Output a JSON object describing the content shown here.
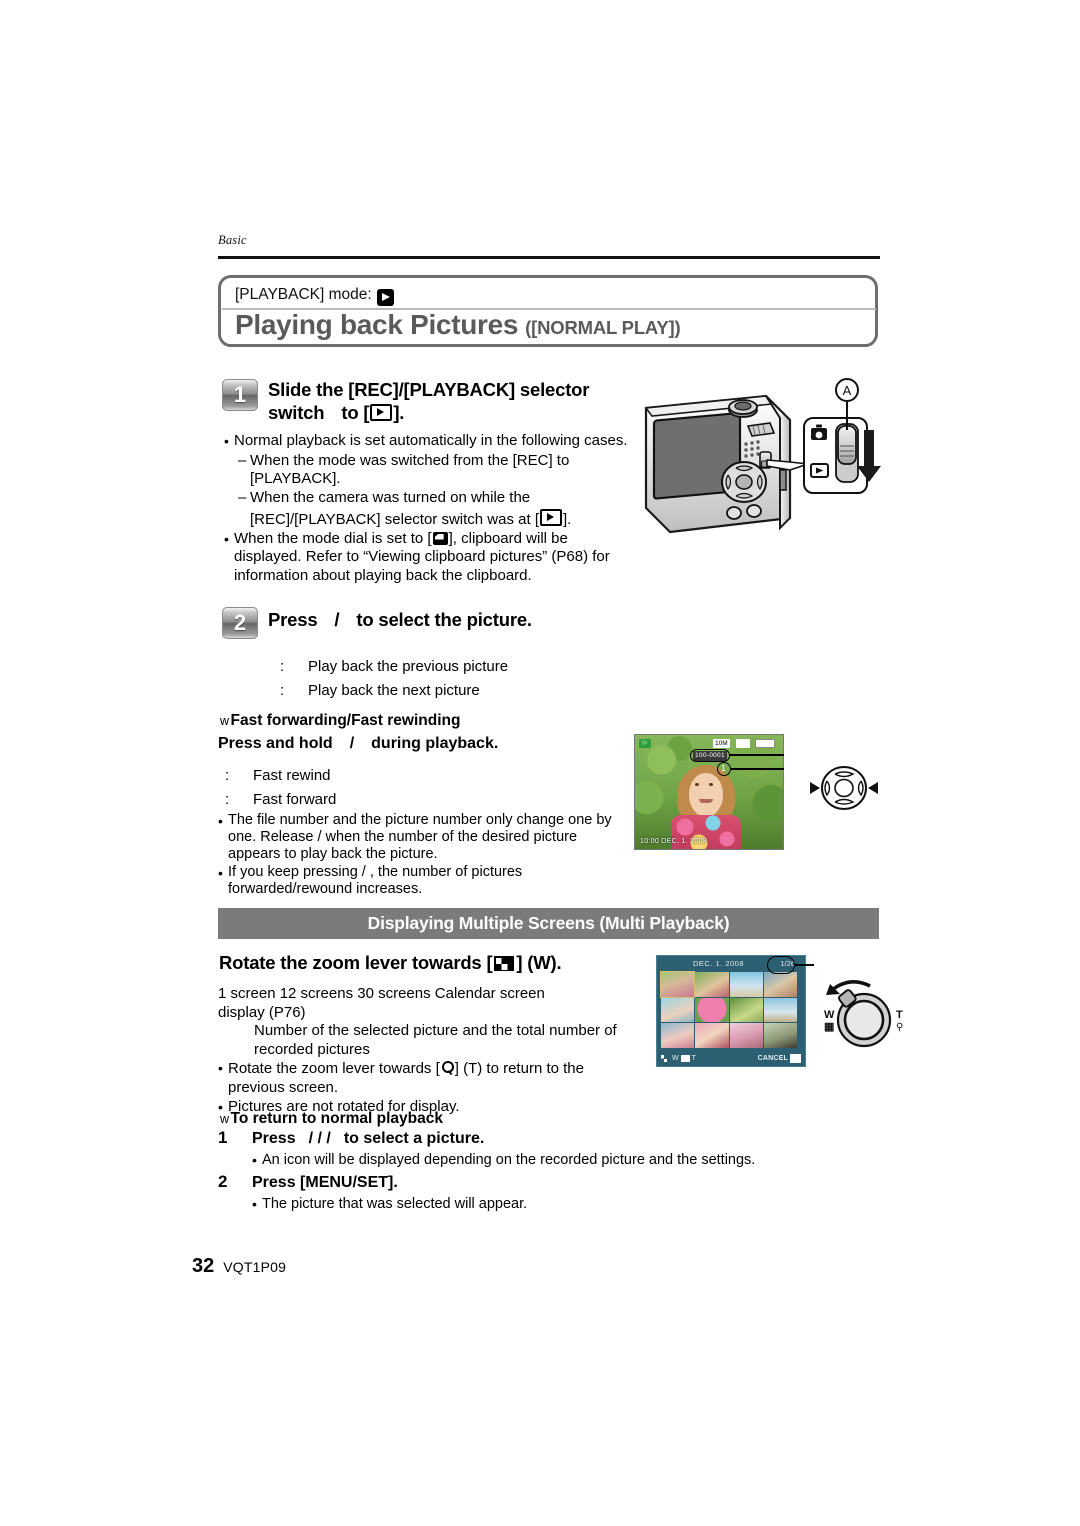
{
  "page": {
    "running_head": "Basic",
    "footer_page_number": "32",
    "footer_code": "VQT1P09"
  },
  "title_panel": {
    "mode_prefix": "[PLAYBACK] mode:",
    "mode_icon": "play-icon",
    "title_main": "Playing back Pictures",
    "title_sub": "([NORMAL PLAY])"
  },
  "step1": {
    "number": "1",
    "heading_line1": "Slide the [REC]/[PLAYBACK] selector",
    "heading_line2_a": "switch",
    "heading_line2_b": "to [",
    "heading_line2_c": "].",
    "bullets": [
      {
        "text": "Normal playback is set automatically in the following cases.",
        "sub": [
          "When the mode was switched from the [REC] to [PLAYBACK].",
          "When the camera was turned on while the [REC]/[PLAYBACK] selector switch was at ["
        ],
        "sub_tail": "]."
      },
      {
        "text_a": "When the mode dial is set to [",
        "text_b": "], clipboard will be displayed. Refer to “Viewing clipboard pictures” (P68) for information about playing back the clipboard."
      }
    ]
  },
  "step2": {
    "number": "2",
    "heading_a": "Press",
    "heading_slash": "/",
    "heading_b": "to select the picture.",
    "key_lines": [
      {
        "colon": ":",
        "text": "Play back the previous picture"
      },
      {
        "colon": ":",
        "text": "Play back the next picture"
      }
    ]
  },
  "fast_forward": {
    "w_mark": "w",
    "heading": "Fast forwarding/Fast rewinding",
    "press_a": "Press and hold",
    "press_slash": "/",
    "press_b": "during playback.",
    "key_lines": [
      {
        "colon": ":",
        "text": "Fast rewind"
      },
      {
        "colon": ":",
        "text": "Fast forward"
      }
    ],
    "notes": [
      "The file number      and the picture number      only change one by one. Release      /      when the number of the desired picture appears to play back the picture.",
      "If you keep pressing      /     , the number of pictures forwarded/rewound increases."
    ]
  },
  "multi_section": {
    "bar_title": "Displaying Multiple Screens (Multi Playback)",
    "heading_a": "Rotate the zoom lever towards [",
    "heading_b": "] (W).",
    "flow_line1": "1 screen      12 screens      30 screens      Calendar screen",
    "flow_line2": "display (P76)",
    "indent_note": "Number of the selected picture and the total number of recorded pictures",
    "bullets": [
      {
        "a": "Rotate the zoom lever towards [",
        "b": "] (T) to return to the previous screen."
      },
      {
        "a": "Pictures are not rotated for display.",
        "b": ""
      }
    ]
  },
  "return_section": {
    "w_mark": "w",
    "heading": "To return to normal playback",
    "items": [
      {
        "number": "1",
        "label_a": "Press",
        "slashes": "/   /   /",
        "label_b": "to select a picture.",
        "note": "An icon will be displayed depending on the recorded picture and the settings."
      },
      {
        "number": "2",
        "label_a": "Press [MENU/SET].",
        "slashes": "",
        "label_b": "",
        "note": "The picture that was selected will appear."
      }
    ]
  },
  "illustrations": {
    "camera": {
      "callout_label": "A",
      "rec_icon": "camera-icon",
      "play_icon": "play-icon"
    },
    "lcd_preview": {
      "resolution": "10M",
      "file_number": "100-0001",
      "picture_number": "1",
      "bottom_info": "10:00  DEC. 1. 2008"
    },
    "multi_playback": {
      "date": "DEC. 1. 2008",
      "counter": "1/26",
      "w_label": "W",
      "t_label": "T",
      "cancel_label": "CANCEL"
    },
    "zoom_lever": {
      "w_label": "W",
      "t_label": "T"
    }
  },
  "colors": {
    "title_gray": "#5a5a5a",
    "bar_gray": "#7b7b7b",
    "panel_border": "#6e6e6e",
    "lcd_blue": "#2d5f73"
  }
}
